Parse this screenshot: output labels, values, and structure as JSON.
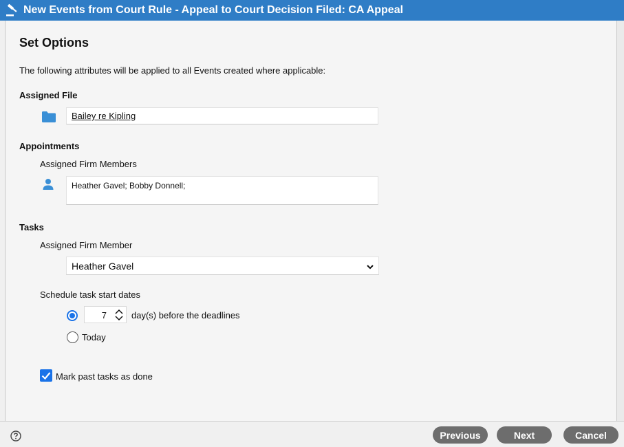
{
  "window": {
    "title": "New Events from Court Rule - Appeal to Court Decision Filed: CA Appeal"
  },
  "page": {
    "heading": "Set Options",
    "intro": "The following attributes will be applied to all Events created where applicable:"
  },
  "assigned_file": {
    "label": "Assigned File",
    "value": "Bailey re Kipling"
  },
  "appointments": {
    "label": "Appointments",
    "members_label": "Assigned Firm Members",
    "members_value": "Heather Gavel; Bobby Donnell;"
  },
  "tasks": {
    "label": "Tasks",
    "member_label": "Assigned Firm Member",
    "member_selected": "Heather Gavel",
    "schedule_label": "Schedule task start dates",
    "days_value": "7",
    "days_suffix": "day(s) before the deadlines",
    "today_label": "Today",
    "mark_done_label": "Mark past tasks as done"
  },
  "footer": {
    "previous_label": "Previous",
    "next_label": "Next",
    "cancel_label": "Cancel"
  },
  "colors": {
    "titlebar": "#2f7dc6",
    "accent": "#1a73e8",
    "icon_blue": "#3a8fd6",
    "button_gray": "#6d6d6d"
  },
  "icons": {
    "title": "gavel-icon",
    "file": "folder-icon",
    "members": "person-icon",
    "help": "help-circle-icon",
    "select": "chevron-down-icon",
    "stepper": "up-down-arrows-icon",
    "check": "checkmark-icon"
  }
}
